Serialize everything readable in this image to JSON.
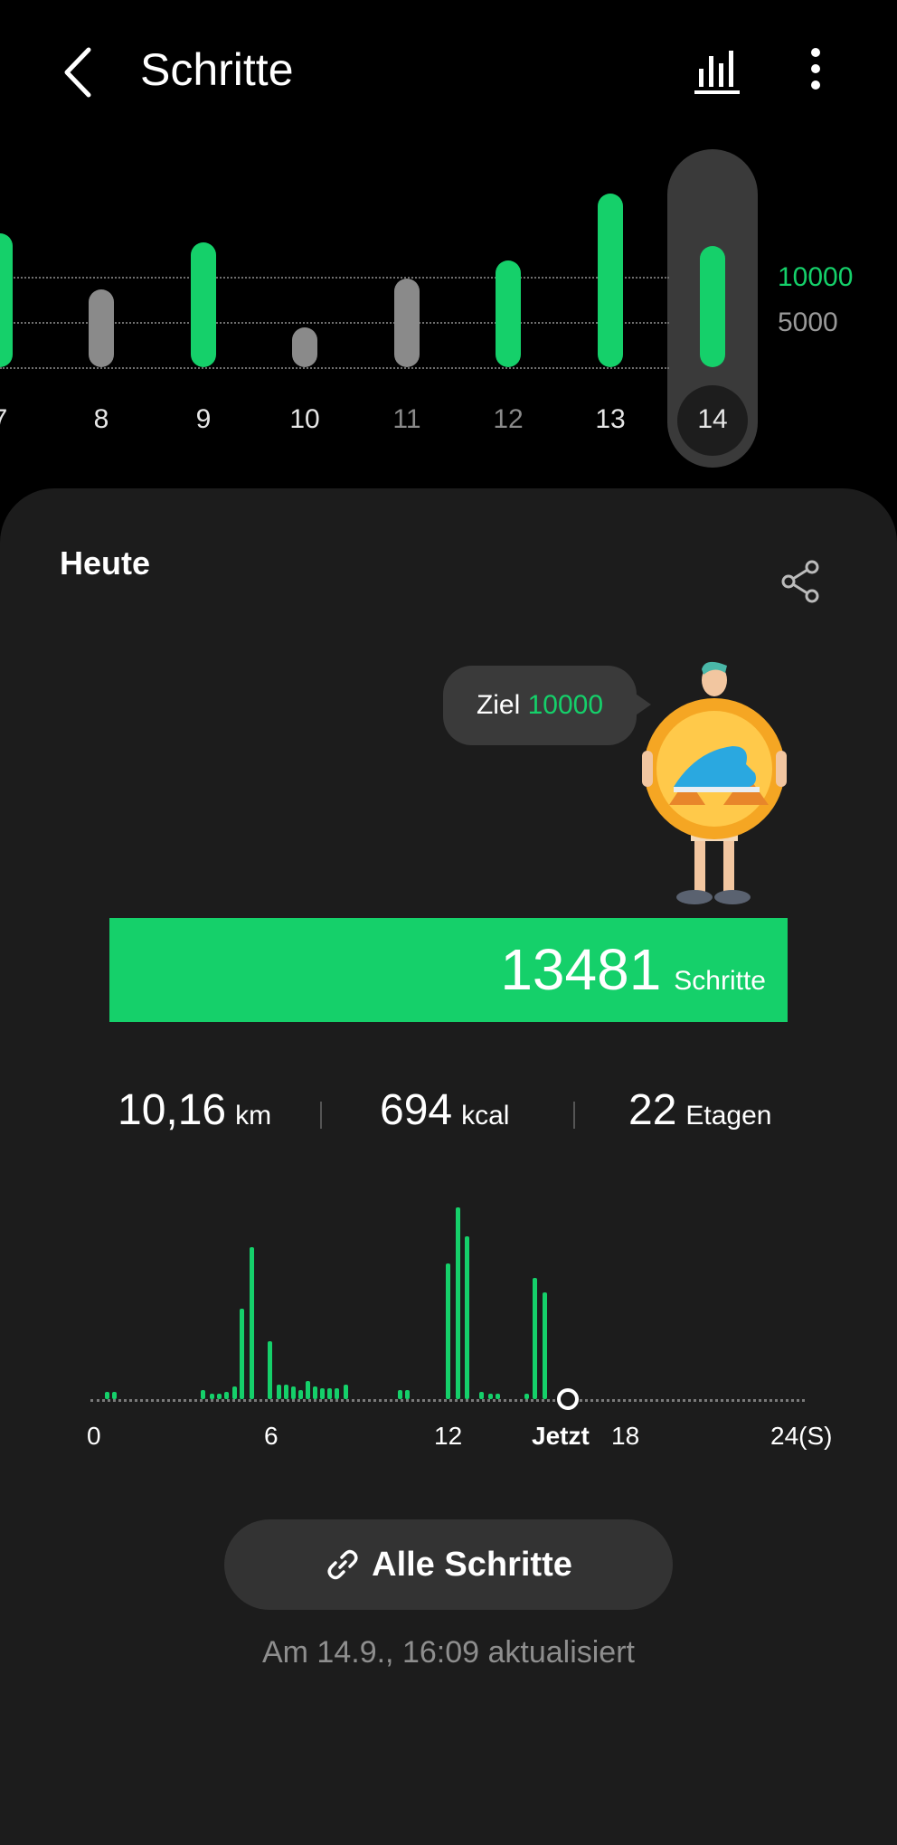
{
  "header": {
    "title": "Schritte",
    "back_icon": "chevron-left-icon",
    "chart_icon": "bar-chart-icon",
    "more_icon": "more-vertical-icon"
  },
  "week_chart": {
    "days": [
      {
        "label": "7",
        "steps_level": "above-goal",
        "dim": false
      },
      {
        "label": "8",
        "steps_level": "below-goal",
        "dim": false
      },
      {
        "label": "9",
        "steps_level": "above-goal",
        "dim": false
      },
      {
        "label": "10",
        "steps_level": "below-goal",
        "dim": false
      },
      {
        "label": "11",
        "steps_level": "below-goal",
        "dim": true
      },
      {
        "label": "12",
        "steps_level": "above-goal",
        "dim": true
      },
      {
        "label": "13",
        "steps_level": "above-goal",
        "dim": false
      },
      {
        "label": "14",
        "steps_level": "above-goal",
        "selected": true
      }
    ],
    "goal_high": "10000",
    "goal_low": "5000",
    "colors": {
      "green": "#15d06a",
      "grey": "#8a8a8a"
    }
  },
  "card": {
    "heading": "Heute",
    "share_icon": "share-icon",
    "bubble_prefix": "Ziel",
    "bubble_goal": "10000",
    "steps_value": "13481",
    "steps_unit": "Schritte",
    "stats": [
      {
        "value": "10,16",
        "unit": "km"
      },
      {
        "value": "694",
        "unit": "kcal"
      },
      {
        "value": "22",
        "unit": "Etagen"
      }
    ],
    "hour_labels": {
      "h0": "0",
      "h6": "6",
      "h12": "12",
      "now": "Jetzt",
      "h18": "18",
      "h24": "24(S)"
    },
    "all_steps_button": "Alle Schritte",
    "link_icon": "link-icon",
    "updated_text": "Am 14.9., 16:09 aktualisiert"
  }
}
